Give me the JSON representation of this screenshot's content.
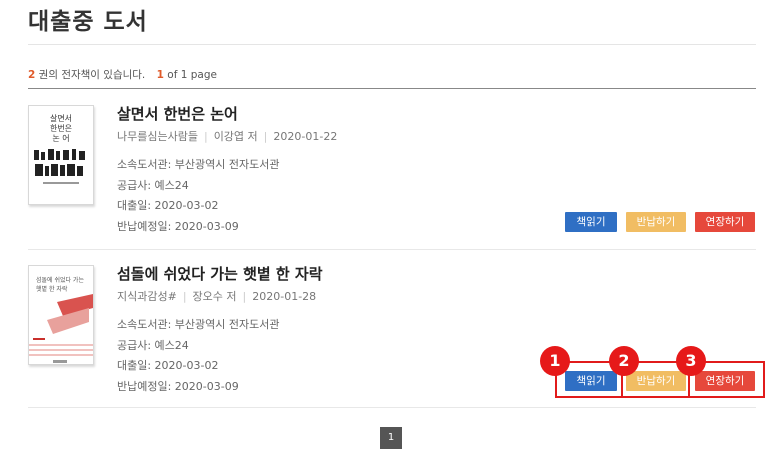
{
  "page": {
    "title": "대출중 도서"
  },
  "summary": {
    "count": "2",
    "count_suffix": "권의 전자책이 있습니다.",
    "current_page": "1",
    "page_suffix": "of 1 page"
  },
  "books": [
    {
      "title": "살면서 한번은 논어",
      "publisher": "나무를심는사람들",
      "author": "이강엽 저",
      "pub_date": "2020-01-22",
      "library": "소속도서관: 부산광역시 전자도서관",
      "supplier": "공급사: 예스24",
      "loan_date": "대출일: 2020-03-02",
      "due_date": "반납예정일: 2020-03-09",
      "cover_text": [
        "살면서",
        "한번은",
        "논 어"
      ]
    },
    {
      "title": "섬돌에 쉬었다 가는 햇볕 한 자락",
      "publisher": "지식과감성#",
      "author": "장오수 저",
      "pub_date": "2020-01-28",
      "library": "소속도서관: 부산광역시 전자도서관",
      "supplier": "공급사: 예스24",
      "loan_date": "대출일: 2020-03-02",
      "due_date": "반납예정일: 2020-03-09",
      "cover_text": [
        "섬돌에 쉬었다 가는",
        "햇볕 한 자락"
      ]
    }
  ],
  "buttons": {
    "read": "책읽기",
    "return": "반납하기",
    "extend": "연장하기"
  },
  "annotations": [
    "1",
    "2",
    "3"
  ],
  "pagination": {
    "page": "1"
  },
  "colors": {
    "accent": "#e05b2b",
    "read": "#2f6fc4",
    "return": "#f1bd63",
    "extend": "#e6483b",
    "highlight": "#e61919"
  }
}
